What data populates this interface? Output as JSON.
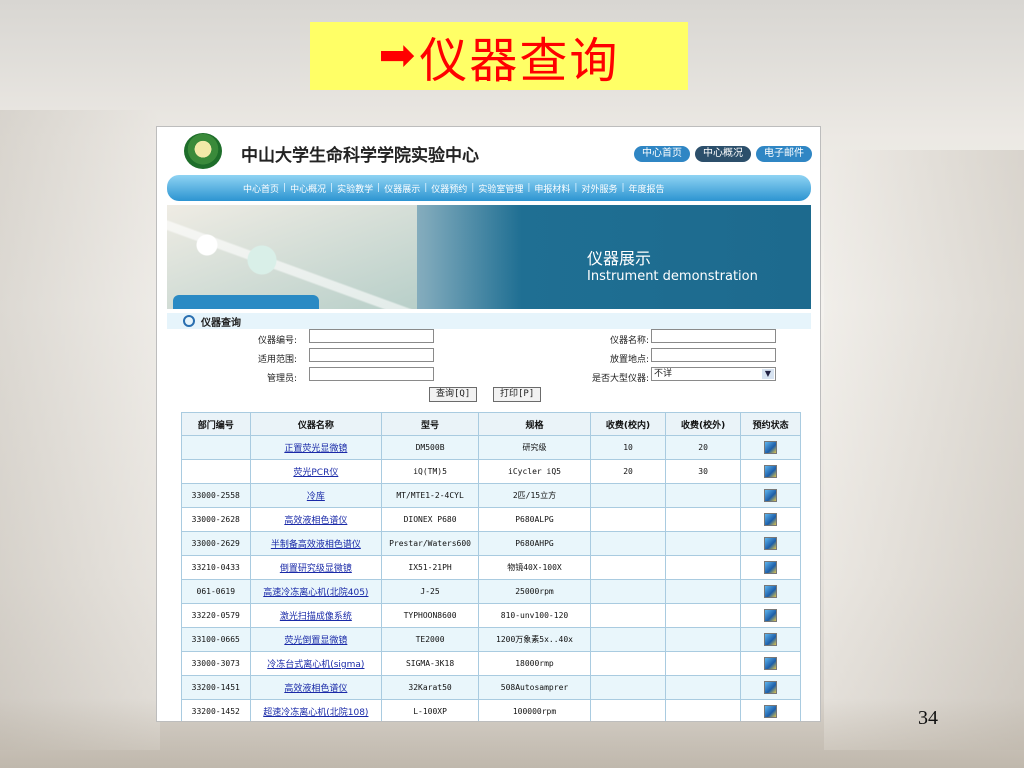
{
  "slide": {
    "title_arrow": "➡",
    "title": "仪器查询",
    "page_number": "34",
    "title_bg": "#ffff66",
    "title_color": "#ff0000"
  },
  "site": {
    "title": "中山大学生命科学学院实验中心",
    "top_links": [
      "中心首页",
      "中心概况",
      "电子邮件"
    ],
    "nav": [
      "中心首页",
      "中心概况",
      "实验教学",
      "仪器展示",
      "仪器预约",
      "实验室管理",
      "申报材料",
      "对外服务",
      "年度报告"
    ]
  },
  "banner": {
    "title_cn": "仪器展示",
    "title_en": "Instrument demonstration"
  },
  "search": {
    "header": "仪器查询",
    "fields": {
      "instrument_no": {
        "label": "仪器编号:",
        "value": ""
      },
      "scope": {
        "label": "适用范围:",
        "value": ""
      },
      "manager": {
        "label": "管理员:",
        "value": ""
      },
      "instrument_name": {
        "label": "仪器名称:",
        "value": ""
      },
      "location": {
        "label": "放置地点:",
        "value": ""
      },
      "large_instrument": {
        "label": "是否大型仪器:",
        "value": "不详"
      }
    },
    "query_button": "查询[Q]",
    "print_button": "打印[P]"
  },
  "table": {
    "headers": [
      "部门编号",
      "仪器名称",
      "型号",
      "规格",
      "收费(校内)",
      "收费(校外)",
      "预约状态"
    ],
    "rows": [
      [
        "",
        "正置荧光显微镜",
        "DM500B",
        "研究级",
        "10",
        "20"
      ],
      [
        "",
        "荧光PCR仪",
        "iQ(TM)5",
        "iCycler iQ5",
        "20",
        "30"
      ],
      [
        "33000-2558",
        "冷库",
        "MT/MTE1-2-4CYL",
        "2匹/15立方",
        "",
        ""
      ],
      [
        "33000-2628",
        "高效液相色谱仪",
        "DIONEX P680",
        "P680ALPG",
        "",
        ""
      ],
      [
        "33000-2629",
        "半制备高效液相色谱仪",
        "Prestar/Waters600",
        "P680AHPG",
        "",
        ""
      ],
      [
        "33210-0433",
        "倒置研究级显微镜",
        "IX51-21PH",
        "物镜40X-100X",
        "",
        ""
      ],
      [
        "061-0619",
        "高速冷冻离心机(北院405)",
        "J-25",
        "25000rpm",
        "",
        ""
      ],
      [
        "33220-0579",
        "激光扫描成像系统",
        "TYPHOON8600",
        "810-unv100-120",
        "",
        ""
      ],
      [
        "33100-0665",
        "荧光倒置显微镜",
        "TE2000",
        "1200万象素5x..40x",
        "",
        ""
      ],
      [
        "33000-3073",
        "冷冻台式离心机(sigma)",
        "SIGMA-3K18",
        "18000rmp",
        "",
        ""
      ],
      [
        "33200-1451",
        "高效液相色谱仪",
        "32Karat50",
        "508Autosamprer",
        "",
        ""
      ],
      [
        "33200-1452",
        "超速冷冻离心机(北院108)",
        "L-100XP",
        "100000rpm",
        "",
        ""
      ]
    ]
  }
}
